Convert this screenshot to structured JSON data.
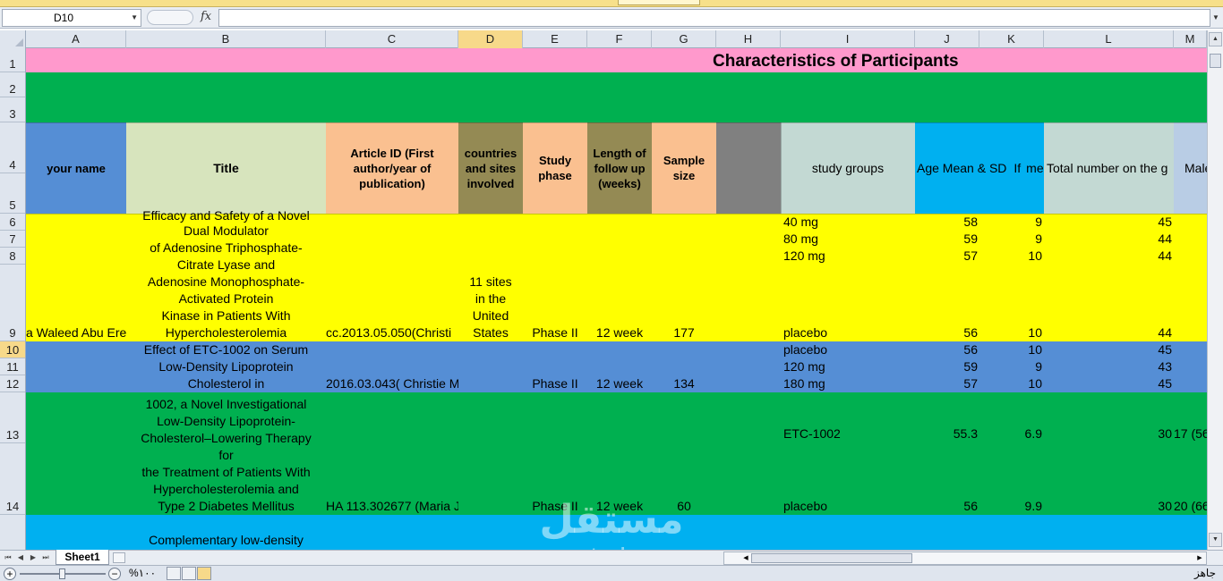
{
  "formula_bar": {
    "name_box": "D10",
    "fx_label": "fx",
    "formula": ""
  },
  "colors": {
    "row1_pink": "#ff99cc",
    "rows23_green": "#00b050",
    "header_blue": "#558ed5",
    "header_green": "#d7e4bd",
    "header_peach": "#fac090",
    "header_olive": "#948a54",
    "header_gray": "#808080",
    "header_mint": "#c3d9d3",
    "header_cyan": "#00b0f0",
    "header_lilac": "#b9cde5",
    "yellow": "#ffff00",
    "blue_band": "#558ed5",
    "green_band": "#00b050",
    "cyan_band": "#00b0f0"
  },
  "columns": [
    "A",
    "B",
    "C",
    "D",
    "E",
    "F",
    "G",
    "H",
    "I",
    "J",
    "K",
    "L",
    "M"
  ],
  "rows": [
    "1",
    "2",
    "3",
    "4",
    "5",
    "6",
    "7",
    "8",
    "9",
    "10",
    "11",
    "12",
    "13",
    "14"
  ],
  "sheet_title": "Characteristics of Participants",
  "headers": {
    "your_name": "your name",
    "title": "Title",
    "article_id": "Article ID (First author/year of publication)",
    "countries": "countries and sites involved",
    "study_phase": "Study phase",
    "length_follow": "Length of follow up (weeks)",
    "sample_size": "Sample size",
    "study_groups": "study groups",
    "age_mean": "Age Mean & SD",
    "age_if": "If",
    "age_me": "me",
    "total_number": "Total number on the g",
    "male": "Male"
  },
  "study1": {
    "title_lines": [
      "Efficacy and Safety of a Novel",
      "Dual Modulator",
      "of Adenosine Triphosphate-",
      "Citrate Lyase and",
      "Adenosine Monophosphate-",
      "Activated Protein",
      "Kinase in Patients With",
      "Hypercholesterolemia"
    ],
    "author": "a Waleed Abu Ere",
    "article_id": "cc.2013.05.050(Christi",
    "countries_lines": [
      "11 sites",
      "in the",
      "United",
      "States"
    ],
    "phase": "Phase II",
    "length": "12 week",
    "sample": "177",
    "groups": [
      {
        "group": "40 mg",
        "age": "58",
        "sd": "9",
        "total": "45"
      },
      {
        "group": "80 mg",
        "age": "59",
        "sd": "9",
        "total": "44"
      },
      {
        "group": "120 mg",
        "age": "57",
        "sd": "10",
        "total": "44"
      },
      {
        "group": "placebo",
        "age": "56",
        "sd": "10",
        "total": "44"
      }
    ]
  },
  "study2": {
    "title_lines": [
      "Effect of ETC-1002 on Serum",
      "Low-Density Lipoprotein",
      "Cholesterol in"
    ],
    "article_id": "2016.03.043( Christie M",
    "phase": "Phase II",
    "length": "12 week",
    "sample": "134",
    "groups": [
      {
        "group": "placebo",
        "age": "56",
        "sd": "10",
        "total": "45"
      },
      {
        "group": "120 mg",
        "age": "59",
        "sd": "9",
        "total": "43"
      },
      {
        "group": "180 mg",
        "age": "57",
        "sd": "10",
        "total": "45"
      }
    ]
  },
  "study3": {
    "title_lines": [
      "1002, a Novel Investigational",
      "Low-Density Lipoprotein-",
      "Cholesterol–Lowering Therapy",
      "for",
      "the Treatment of Patients With",
      "Hypercholesterolemia and",
      "Type 2 Diabetes Mellitus"
    ],
    "article_id": "HA 113.302677 (Maria J",
    "phase": "Phase II",
    "length": "12 week",
    "sample": "60",
    "groups": [
      {
        "group": "ETC-1002",
        "age": "55.3",
        "sd": "6.9",
        "total": "30",
        "male": "17 (56"
      },
      {
        "group": "placebo",
        "age": "56",
        "sd": "9.9",
        "total": "30",
        "male": "20 (66"
      }
    ]
  },
  "study4": {
    "title_line": "Complementary low-density"
  },
  "sheet_tabs": [
    "Sheet1"
  ],
  "status": {
    "ready": "جاهز",
    "zoom": "%١٠٠"
  },
  "watermark": {
    "arabic": "مستقل",
    "latin": "mostaql.com"
  }
}
